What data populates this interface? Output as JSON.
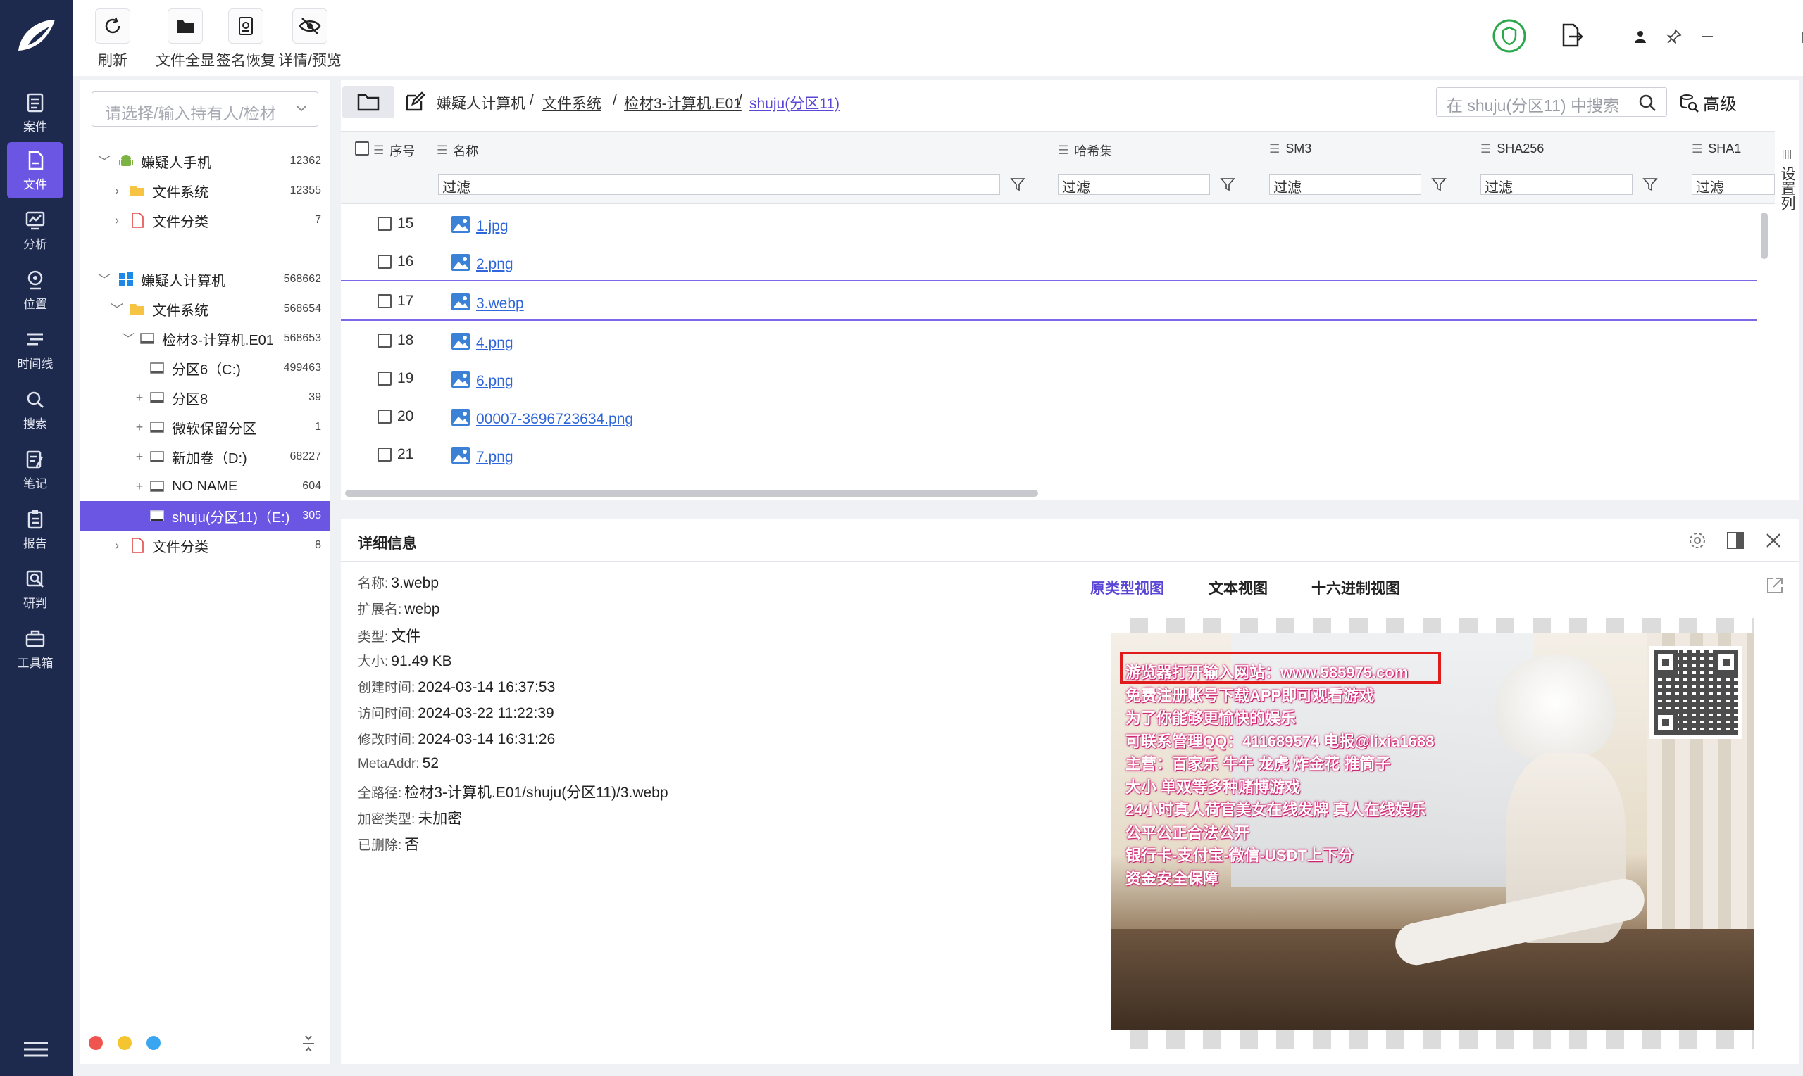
{
  "nav": [
    {
      "label": "案件",
      "icon": "case-icon"
    },
    {
      "label": "文件",
      "icon": "file-icon",
      "active": true
    },
    {
      "label": "分析",
      "icon": "analysis-icon"
    },
    {
      "label": "位置",
      "icon": "location-icon"
    },
    {
      "label": "时间线",
      "icon": "timeline-icon"
    },
    {
      "label": "搜索",
      "icon": "search-icon"
    },
    {
      "label": "笔记",
      "icon": "notes-icon"
    },
    {
      "label": "报告",
      "icon": "report-icon"
    },
    {
      "label": "研判",
      "icon": "research-icon"
    },
    {
      "label": "工具箱",
      "icon": "toolbox-icon"
    }
  ],
  "toolbar": {
    "refresh": "刷新",
    "show_all": "文件全显",
    "sig_recover": "签名恢复",
    "detail_preview": "详情/预览"
  },
  "tree": {
    "selector_placeholder": "请选择/输入持有人/检材",
    "rows": [
      {
        "label": "嫌疑人手机",
        "count": "12362"
      },
      {
        "label": "文件系统",
        "count": "12355"
      },
      {
        "label": "文件分类",
        "count": "7"
      },
      {
        "label": "嫌疑人计算机",
        "count": "568662"
      },
      {
        "label": "文件系统",
        "count": "568654"
      },
      {
        "label": "检材3-计算机.E01",
        "count": "568653"
      },
      {
        "label": "分区6（C:)",
        "count": "499463"
      },
      {
        "label": "分区8",
        "count": "39"
      },
      {
        "label": "微软保留分区",
        "count": "1"
      },
      {
        "label": "新加卷（D:)",
        "count": "68227"
      },
      {
        "label": "NO NAME",
        "count": "604"
      },
      {
        "label": "shuju(分区11)（E:)",
        "count": "305"
      },
      {
        "label": "文件分类",
        "count": "8"
      }
    ]
  },
  "breadcrumb": {
    "c1": "嫌疑人计算机",
    "c2": "文件系统",
    "c3": "检材3-计算机.E01",
    "c4": "shuju(分区11)",
    "sep": "/"
  },
  "search": {
    "placeholder": "在 shuju(分区11) 中搜索"
  },
  "advanced_label": "高级",
  "grid": {
    "headers": {
      "seq": "序号",
      "name": "名称",
      "hash_set": "哈希集",
      "sm3": "SM3",
      "sha256": "SHA256",
      "sha1": "SHA1"
    },
    "filter_placeholder": "过滤",
    "column_settings": "设置列",
    "rows": [
      {
        "seq": "15",
        "name": "1.jpg"
      },
      {
        "seq": "16",
        "name": "2.png"
      },
      {
        "seq": "17",
        "name": "3.webp"
      },
      {
        "seq": "18",
        "name": "4.png"
      },
      {
        "seq": "19",
        "name": "6.png"
      },
      {
        "seq": "20",
        "name": "00007-3696723634.png"
      },
      {
        "seq": "21",
        "name": "7.png"
      }
    ]
  },
  "detail": {
    "title": "详细信息",
    "fields": [
      {
        "key": "名称:",
        "value": "3.webp"
      },
      {
        "key": "扩展名:",
        "value": "webp"
      },
      {
        "key": "类型:",
        "value": "文件"
      },
      {
        "key": "大小:",
        "value": "91.49 KB"
      },
      {
        "key": "创建时间:",
        "value": "2024-03-14 16:37:53"
      },
      {
        "key": "访问时间:",
        "value": "2024-03-22 11:22:39"
      },
      {
        "key": "修改时间:",
        "value": "2024-03-14 16:31:26"
      },
      {
        "key": "MetaAddr:",
        "value": "52"
      },
      {
        "key": "全路径:",
        "value": "检材3-计算机.E01/shuju(分区11)/3.webp"
      },
      {
        "key": "加密类型:",
        "value": "未加密"
      },
      {
        "key": "已删除:",
        "value": "否"
      }
    ],
    "tabs": {
      "original": "原类型视图",
      "text": "文本视图",
      "hex": "十六进制视图"
    }
  },
  "preview": {
    "ad_lines": [
      "游览器打开输入网站：www.585975.com",
      "免费注册账号下载APP即可观看游戏",
      "为了你能够更愉快的娱乐",
      "可联系管理QQ：411689574 电报@lixia1688",
      "主营：百家乐 牛牛 龙虎 炸金花 推筒子",
      "大小 单双等多种赌博游戏",
      "24小时真人荷官美女在线发牌 真人在线娱乐",
      "公平公正合法公开",
      "银行卡-支付宝-微信-USDT上下分",
      "资金安全保障"
    ]
  },
  "colors": {
    "accent": "#6b55e3",
    "rail": "#1e2a4d",
    "link": "#2f66d9",
    "highlight_box": "#e11b1b",
    "dot_red": "#f0544f",
    "dot_yellow": "#f5c531",
    "dot_blue": "#3aa5f0"
  }
}
